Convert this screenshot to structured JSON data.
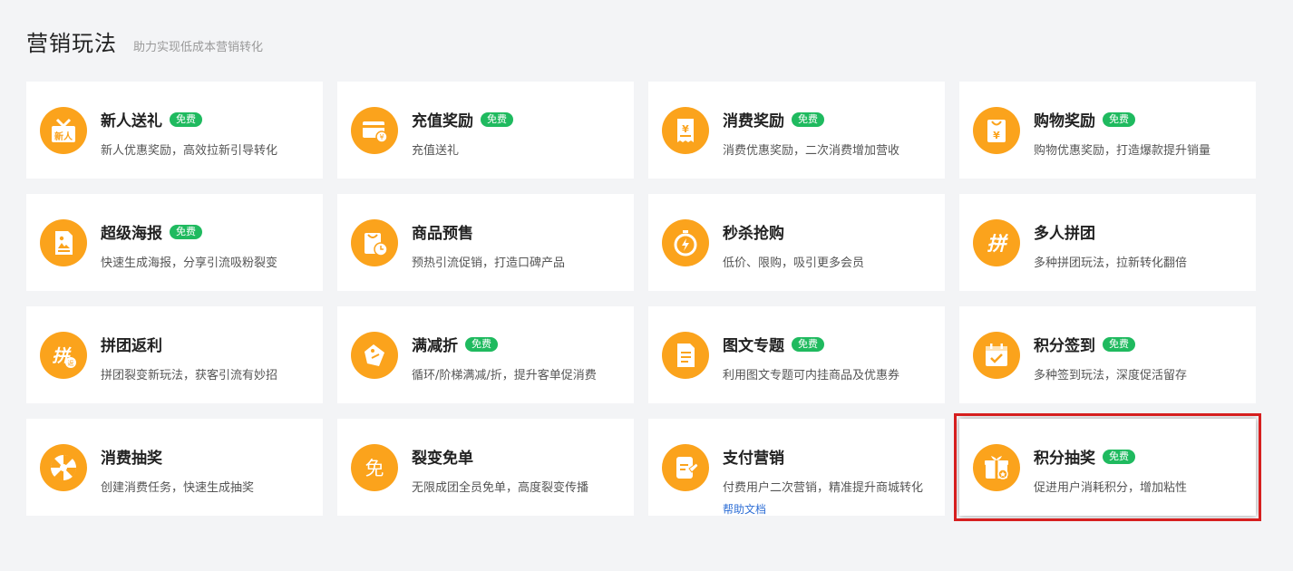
{
  "header": {
    "title": "营销玩法",
    "subtitle": "助力实现低成本营销转化"
  },
  "free_label": "免费",
  "help_link": "帮助文档",
  "cards": [
    {
      "name": "新人送礼",
      "desc": "新人优惠奖励，高效拉新引导转化",
      "icon": "gift-icon"
    },
    {
      "name": "充值奖励",
      "desc": "充值送礼",
      "icon": "card-yen-icon"
    },
    {
      "name": "消费奖励",
      "desc": "消费优惠奖励，二次消费增加营收",
      "icon": "receipt-yen-icon"
    },
    {
      "name": "购物奖励",
      "desc": "购物优惠奖励，打造爆款提升销量",
      "icon": "bag-yen-icon"
    },
    {
      "name": "超级海报",
      "desc": "快速生成海报，分享引流吸粉裂变",
      "icon": "poster-icon"
    },
    {
      "name": "商品预售",
      "desc": "预热引流促销，打造口碑产品",
      "icon": "presale-bag-icon"
    },
    {
      "name": "秒杀抢购",
      "desc": "低价、限购，吸引更多会员",
      "icon": "stopwatch-icon"
    },
    {
      "name": "多人拼团",
      "desc": "多种拼团玩法，拉新转化翻倍",
      "icon": "pin-icon"
    },
    {
      "name": "拼团返利",
      "desc": "拼团裂变新玩法，获客引流有妙招",
      "icon": "pin-rebate-icon"
    },
    {
      "name": "满减折",
      "desc": "循环/阶梯满减/折，提升客单促消费",
      "icon": "tag-icon"
    },
    {
      "name": "图文专题",
      "desc": "利用图文专题可内挂商品及优惠券",
      "icon": "document-icon"
    },
    {
      "name": "积分签到",
      "desc": "多种签到玩法，深度促活留存",
      "icon": "calendar-check-icon"
    },
    {
      "name": "消费抽奖",
      "desc": "创建消费任务，快速生成抽奖",
      "icon": "wheel-icon"
    },
    {
      "name": "裂变免单",
      "desc": "无限成团全员免单，高度裂变传播",
      "icon": "free-order-icon"
    },
    {
      "name": "支付营销",
      "desc": "付费用户二次营销，精准提升商城转化",
      "icon": "payment-icon"
    },
    {
      "name": "积分抽奖",
      "desc": "促进用户消耗积分，增加粘性",
      "icon": "points-gift-icon"
    }
  ]
}
